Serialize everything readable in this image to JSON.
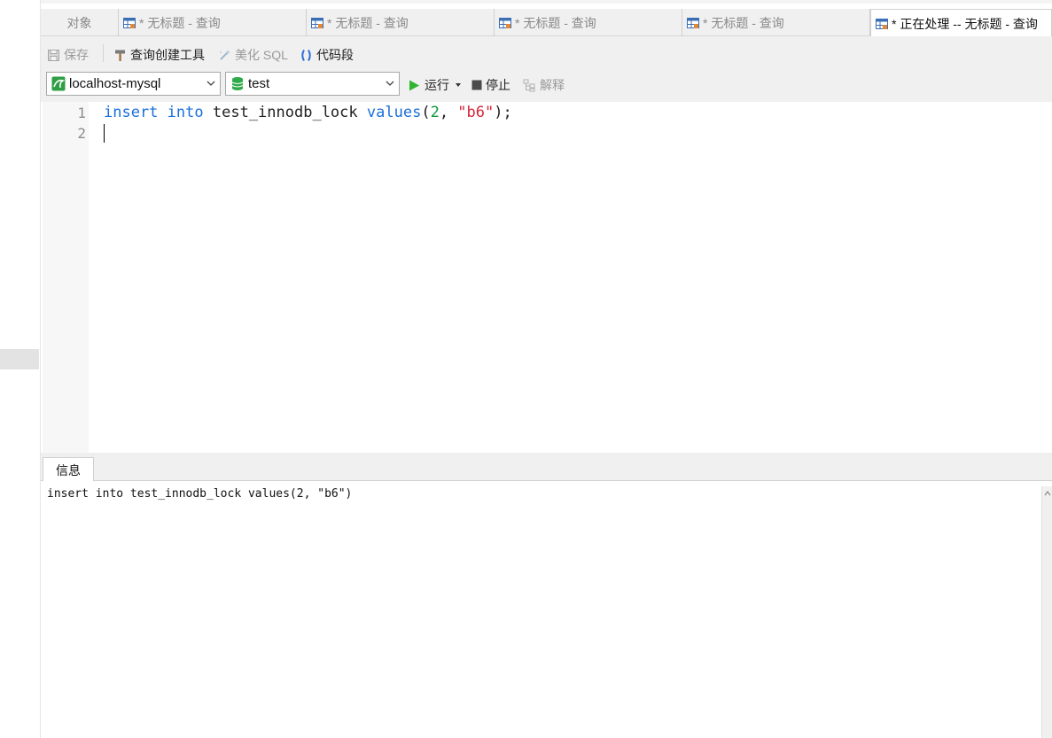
{
  "tabs": [
    {
      "label": "对象",
      "icon": "none",
      "active": false
    },
    {
      "label": "* 无标题 - 查询",
      "icon": "query-table-icon",
      "active": false
    },
    {
      "label": "* 无标题 - 查询",
      "icon": "query-table-icon",
      "active": false
    },
    {
      "label": "* 无标题 - 查询",
      "icon": "query-table-icon",
      "active": false
    },
    {
      "label": "* 无标题 - 查询",
      "icon": "query-table-icon",
      "active": false
    },
    {
      "label": "* 正在处理 -- 无标题 - 查询",
      "icon": "query-table-icon",
      "active": true
    }
  ],
  "toolbar": {
    "save_label": "保存",
    "query_builder_label": "查询创建工具",
    "beautify_label": "美化 SQL",
    "snippet_label": "代码段",
    "run_label": "运行",
    "stop_label": "停止",
    "explain_label": "解释"
  },
  "connection": {
    "selected": "localhost-mysql",
    "database": "test"
  },
  "editor": {
    "line_numbers": [
      "1",
      "2"
    ],
    "line1": {
      "kw_insert": "insert",
      "kw_into": "into",
      "table": "test_innodb_lock",
      "kw_values": "values",
      "open": "(",
      "num": "2",
      "comma": ", ",
      "str": "\"b6\"",
      "close": ");"
    }
  },
  "info": {
    "tab_label": "信息",
    "message": "insert into test_innodb_lock values(2, \"b6\")"
  },
  "colors": {
    "keyword": "#1a6fdc",
    "number": "#0a9b3c",
    "string": "#d8253a",
    "run": "#2fb52f"
  }
}
